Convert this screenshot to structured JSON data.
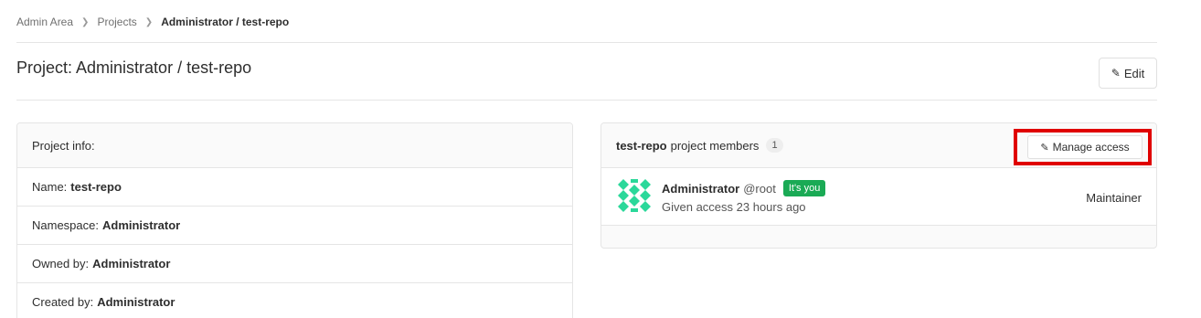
{
  "breadcrumb": {
    "items": [
      "Admin Area",
      "Projects"
    ],
    "current": "Administrator / test-repo"
  },
  "page": {
    "title": "Project: Administrator / test-repo",
    "edit_label": "Edit"
  },
  "project_info": {
    "header": "Project info:",
    "rows": [
      {
        "label": "Name:",
        "value": "test-repo"
      },
      {
        "label": "Namespace:",
        "value": "Administrator"
      },
      {
        "label": "Owned by:",
        "value": "Administrator"
      },
      {
        "label": "Created by:",
        "value": "Administrator"
      }
    ]
  },
  "members": {
    "project_name": "test-repo",
    "header_suffix": "project members",
    "count": "1",
    "manage_label": "Manage access",
    "list": [
      {
        "name": "Administrator",
        "username": "@root",
        "badge": "It's you",
        "sub": "Given access 23 hours ago",
        "role": "Maintainer"
      }
    ]
  },
  "colors": {
    "highlight": "#e00000",
    "badge_green": "#1aaa55",
    "avatar_green": "#2bd89a"
  }
}
